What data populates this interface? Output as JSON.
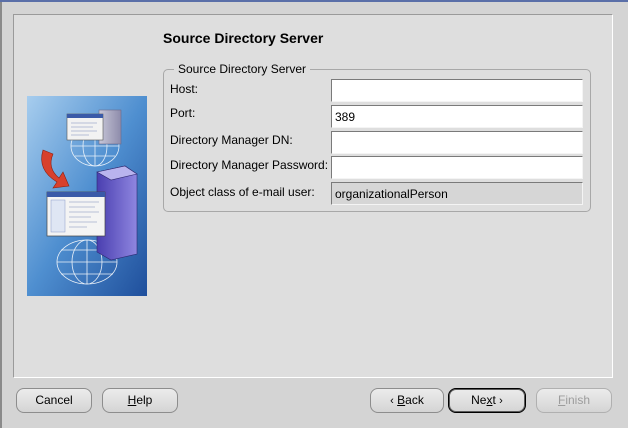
{
  "page": {
    "title": "Source Directory Server"
  },
  "group": {
    "legend": "Source Directory Server"
  },
  "fields": {
    "host": {
      "label": "Host:",
      "value": ""
    },
    "port": {
      "label": "Port:",
      "value": "389"
    },
    "manager_dn": {
      "label": "Directory Manager DN:",
      "value": ""
    },
    "manager_password": {
      "label": "Directory Manager Password:",
      "value": ""
    },
    "object_class": {
      "label": "Object class of e-mail user:",
      "value": "organizationalPerson"
    }
  },
  "buttons": {
    "cancel": {
      "label": "Cancel"
    },
    "help": {
      "label": "Help",
      "mnemonic": "H",
      "rest": "elp"
    },
    "back": {
      "label": "Back",
      "mnemonic": "B",
      "rest": "ack",
      "arrow": "‹"
    },
    "next": {
      "label": "Next",
      "prefix": "Ne",
      "mnemonic": "x",
      "rest": "t",
      "arrow": "›"
    },
    "finish": {
      "label": "Finish",
      "mnemonic": "F",
      "rest": "inish",
      "enabled": false
    }
  },
  "illustration": {
    "icon": "directory-migration-icon"
  },
  "colors": {
    "window_background": "#d4d4d4",
    "panel_background": "#dedede",
    "title_strip": "#5a6fa8",
    "illustration_sky": "#5a9ad8"
  }
}
